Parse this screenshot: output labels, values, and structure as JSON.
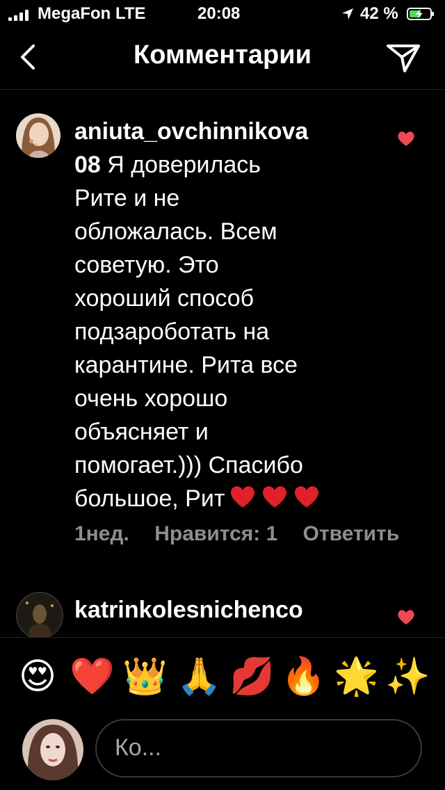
{
  "status_bar": {
    "carrier": "MegaFon LTE",
    "time": "20:08",
    "battery_percent": "42 %"
  },
  "header": {
    "title": "Комментарии"
  },
  "comments": [
    {
      "username": "aniuta_ovchinnikova08",
      "username_part1": "aniuta_ovchinnikova",
      "username_part2": "08",
      "text": "Я доверилась Рите и не обложалась. Всем советую. Это хороший способ подзароботать на карантине. Рита все очень хорошо объясняет и помогает.))) Спасибо большое, Рит",
      "lines": [
        "Рите и не",
        "обложалась. Всем",
        "советую. Это",
        "хороший способ",
        "подзароботать на",
        "карантине. Рита все",
        "очень хорошо",
        "объясняет и",
        "помогает.))) Спасибо"
      ],
      "first_line": "Я доверилась",
      "last_line": "большое, Рит",
      "age": "1нед.",
      "likes": "Нравится: 1",
      "reply": "Ответить"
    },
    {
      "username": "katrinkolesnichenco"
    }
  ],
  "emoji_bar": [
    "😍",
    "❤️",
    "👑",
    "🙏",
    "💋",
    "🔥",
    "🌟",
    "✨"
  ],
  "input": {
    "placeholder": "Ко..."
  },
  "icons": [
    "signal-icon",
    "location-arrow-icon",
    "battery-charging-icon",
    "back-chevron-icon",
    "send-icon",
    "heart-icon"
  ],
  "colors": {
    "background": "#000000",
    "like_heart": "#ed4956",
    "meta_text": "#8e8e8e",
    "battery_fill": "#4cd964"
  }
}
